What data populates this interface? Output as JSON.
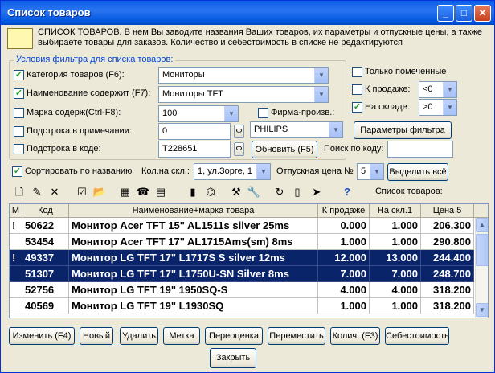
{
  "window": {
    "title": "Список товаров"
  },
  "info": {
    "text": "СПИСОК ТОВАРОВ. В нем Вы заводите названия Ваших товаров, их параметры и отпускные цены, а также выбираете товары для заказов. Количество и себестоимость в списке не редактируются"
  },
  "filter": {
    "group_label": "Условия фильтра для списка товаров:",
    "category": {
      "label": "Категория товаров (F6):",
      "checked": true,
      "value": "Мониторы"
    },
    "name_contains": {
      "label": "Наименование содержит (F7):",
      "checked": true,
      "value": "Мониторы TFT"
    },
    "brand_contains": {
      "label": "Марка содерж(Ctrl-F8):",
      "checked": false,
      "value": "100"
    },
    "firm_maker": {
      "label": "Фирма-произв.:",
      "checked": false,
      "value": "PHILIPS"
    },
    "note_substring": {
      "label": "Подстрока в примечании:",
      "checked": false,
      "value": "0"
    },
    "code_substring": {
      "label": "Подстрока в коде:",
      "checked": false,
      "value": "T228651"
    },
    "only_marked": {
      "label": "Только помеченные",
      "checked": false
    },
    "for_sale": {
      "label": "К продаже:",
      "checked": false,
      "value": "<0"
    },
    "in_stock": {
      "label": "На складе:",
      "checked": true,
      "value": ">0"
    },
    "params_button": "Параметры фильтра",
    "refresh_button": "Обновить (F5)",
    "search_code_label": "Поиск по коду:",
    "search_code_value": ""
  },
  "options": {
    "sort_by_name": {
      "label": "Сортировать по названию",
      "checked": true
    },
    "stock_count_label": "Кол.на скл.:",
    "stock_select": "1, ул.Зорге, 1",
    "price_label": "Отпускная цена №",
    "price_number": "5",
    "select_all_button": "Выделить всё"
  },
  "toolbar": {
    "list_label": "Список товаров:"
  },
  "table": {
    "columns": [
      "М",
      "Код",
      "Наименование+марка товара",
      "К продаже",
      "На скл.1",
      "Цена 5"
    ],
    "rows": [
      {
        "mark": "!",
        "code": "50622",
        "name": "Монитор Acer TFT 15\" AL1511s silver 25ms",
        "for_sale": "0.000",
        "stock": "1.000",
        "price": "206.300",
        "selected": false
      },
      {
        "mark": "",
        "code": "53454",
        "name": "Монитор Acer TFT 17\" AL1715Ams(sm) 8ms",
        "for_sale": "1.000",
        "stock": "1.000",
        "price": "290.800",
        "selected": false
      },
      {
        "mark": "!",
        "code": "49337",
        "name": "Монитор LG TFT 17\" L1717S S silver 12ms",
        "for_sale": "12.000",
        "stock": "13.000",
        "price": "244.400",
        "selected": true
      },
      {
        "mark": "",
        "code": "51307",
        "name": "Монитор LG TFT 17\" L1750U-SN Silver 8ms",
        "for_sale": "7.000",
        "stock": "7.000",
        "price": "248.700",
        "selected": true
      },
      {
        "mark": "",
        "code": "52756",
        "name": "Монитор LG TFT 19\" 1950SQ-S",
        "for_sale": "4.000",
        "stock": "4.000",
        "price": "318.200",
        "selected": false
      },
      {
        "mark": "",
        "code": "40569",
        "name": "Монитор LG TFT 19\" L1930SQ",
        "for_sale": "1.000",
        "stock": "1.000",
        "price": "318.200",
        "selected": false
      }
    ]
  },
  "buttons": {
    "edit": "Изменить (F4)",
    "new": "Новый",
    "delete": "Удалить",
    "mark": "Метка",
    "reprice": "Переоценка",
    "move": "Переместить",
    "qty": "Колич. (F3)",
    "cost": "Себестоимость",
    "close": "Закрыть"
  }
}
